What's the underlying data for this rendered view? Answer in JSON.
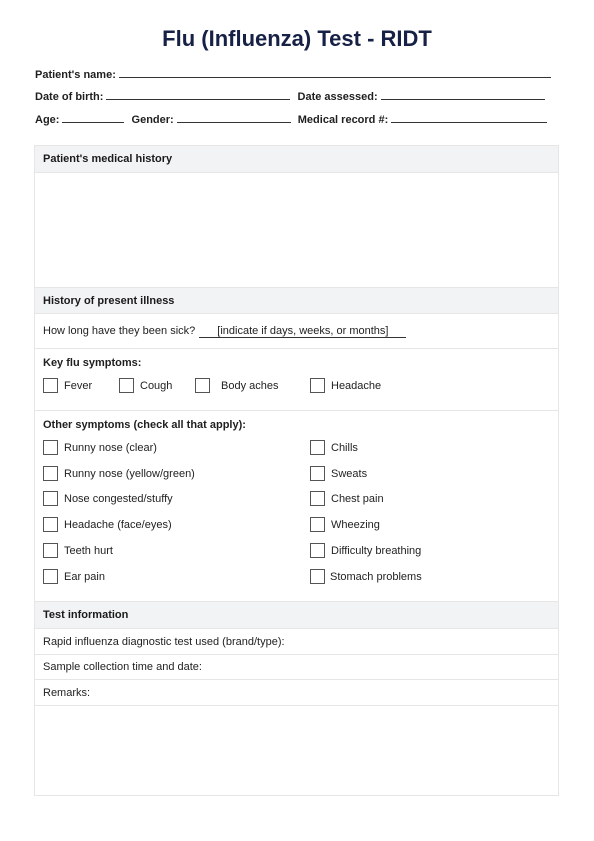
{
  "title": "Flu (Influenza) Test - RIDT",
  "header_fields": {
    "patient_name": "Patient's name:",
    "date_of_birth": "Date of birth:",
    "date_assessed": "Date assessed:",
    "age": "Age:",
    "gender": "Gender:",
    "medical_record": "Medical record #:"
  },
  "medical_history": {
    "heading": "Patient's medical history"
  },
  "present_illness": {
    "heading": "History of present illness",
    "duration_question": "How long have they been sick?",
    "duration_hint": "[indicate if days, weeks, or months]",
    "key_symptoms_label": "Key flu symptoms:",
    "key_symptoms": [
      "Fever",
      "Cough",
      "Body aches",
      "Headache"
    ],
    "other_symptoms_label": "Other symptoms (check all that apply):",
    "other_symptoms_left": [
      "Runny nose (clear)",
      "Runny nose (yellow/green)",
      "Nose congested/stuffy",
      "Headache (face/eyes)",
      "Teeth hurt",
      "Ear pain"
    ],
    "other_symptoms_right": [
      "Chills",
      "Sweats",
      "Chest pain",
      "Wheezing",
      "Difficulty breathing",
      "Stomach problems"
    ]
  },
  "test_information": {
    "heading": "Test information",
    "rdt_used": "Rapid influenza diagnostic test used (brand/type):",
    "sample_time": "Sample collection time and date:",
    "remarks": "Remarks:"
  }
}
